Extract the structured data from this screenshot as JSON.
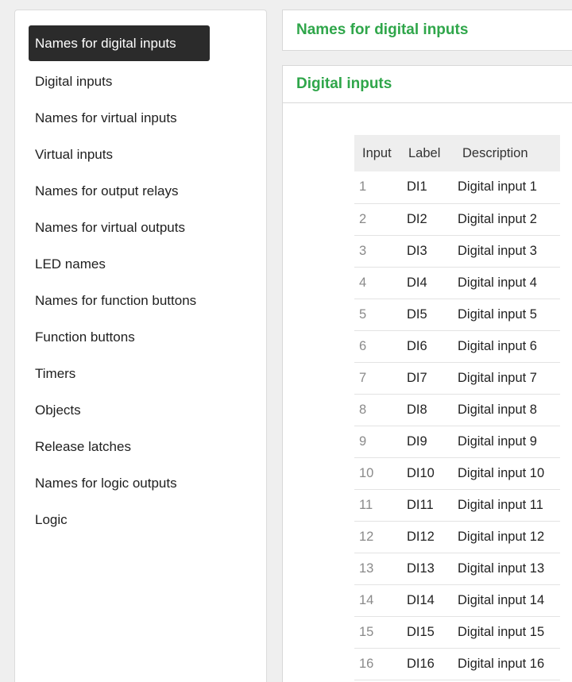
{
  "sidebar": {
    "items": [
      {
        "label": "Names for digital inputs",
        "active": true
      },
      {
        "label": "Digital inputs"
      },
      {
        "label": "Names for virtual inputs"
      },
      {
        "label": "Virtual inputs"
      },
      {
        "label": "Names for output relays"
      },
      {
        "label": "Names for virtual outputs"
      },
      {
        "label": "LED names"
      },
      {
        "label": "Names for function buttons"
      },
      {
        "label": "Function buttons"
      },
      {
        "label": "Timers"
      },
      {
        "label": "Objects"
      },
      {
        "label": "Release latches"
      },
      {
        "label": "Names for logic outputs"
      },
      {
        "label": "Logic"
      }
    ]
  },
  "main": {
    "page_title": "Names for digital inputs",
    "section_title": "Digital inputs",
    "table": {
      "columns": [
        "Input",
        "Label",
        "Description"
      ],
      "rows": [
        {
          "input": "1",
          "label": "DI1",
          "description": "Digital input 1"
        },
        {
          "input": "2",
          "label": "DI2",
          "description": "Digital input 2"
        },
        {
          "input": "3",
          "label": "DI3",
          "description": "Digital input 3"
        },
        {
          "input": "4",
          "label": "DI4",
          "description": "Digital input 4"
        },
        {
          "input": "5",
          "label": "DI5",
          "description": "Digital input 5"
        },
        {
          "input": "6",
          "label": "DI6",
          "description": "Digital input 6"
        },
        {
          "input": "7",
          "label": "DI7",
          "description": "Digital input 7"
        },
        {
          "input": "8",
          "label": "DI8",
          "description": "Digital input 8"
        },
        {
          "input": "9",
          "label": "DI9",
          "description": "Digital input 9"
        },
        {
          "input": "10",
          "label": "DI10",
          "description": "Digital input 10"
        },
        {
          "input": "11",
          "label": "DI11",
          "description": "Digital input 11"
        },
        {
          "input": "12",
          "label": "DI12",
          "description": "Digital input 12"
        },
        {
          "input": "13",
          "label": "DI13",
          "description": "Digital input 13"
        },
        {
          "input": "14",
          "label": "DI14",
          "description": "Digital input 14"
        },
        {
          "input": "15",
          "label": "DI15",
          "description": "Digital input 15"
        },
        {
          "input": "16",
          "label": "DI16",
          "description": "Digital input 16"
        }
      ]
    }
  },
  "colors": {
    "accent_green": "#2fa64a",
    "active_nav_bg": "#2b2b2b",
    "header_row_bg": "#eeeeee"
  }
}
